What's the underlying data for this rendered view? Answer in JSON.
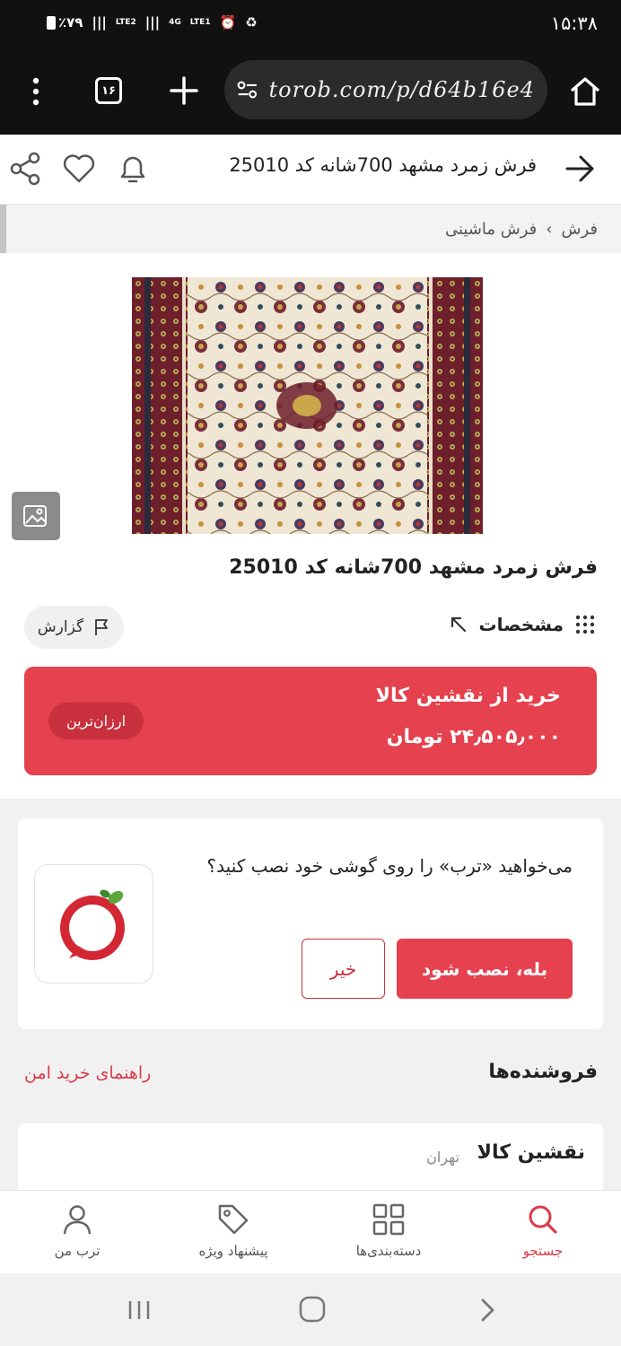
{
  "status_bar": {
    "time": "۱۵:۳۸",
    "battery": "٪۷۹",
    "network_1": "LTE2",
    "network_2": "LTE1",
    "network_type": "4G"
  },
  "browser": {
    "url": "torob.com/p/d64b16e4",
    "tab_count": "۱۶"
  },
  "header": {
    "title": "فرش زمرد مشهد 700شانه کد 25010"
  },
  "breadcrumb": {
    "items": [
      "فرش",
      "فرش ماشینی"
    ],
    "separator": "›"
  },
  "product": {
    "title": "فرش زمرد مشهد 700شانه کد 25010",
    "specs_label": "مشخصات",
    "report_label": "گزارش",
    "buy_line1": "خرید از نقشین کالا",
    "buy_price": "۲۴٫۵۰۵٫۰۰۰ تومان",
    "cheapest_badge": "ارزان‌ترین"
  },
  "install_prompt": {
    "text": "می‌خواهید «ترب» را روی گوشی خود نصب کنید؟",
    "yes_label": "بله، نصب شود",
    "no_label": "خیر"
  },
  "sellers": {
    "heading": "فروشنده‌ها",
    "safe_guide": "راهنمای خرید امن",
    "first_seller_name": "نقشین کالا",
    "first_seller_city": "تهران"
  },
  "bottom_nav": {
    "items": [
      {
        "label": "جستجو",
        "icon": "search-icon",
        "active": true
      },
      {
        "label": "دسته‌بندی‌ها",
        "icon": "grid-icon",
        "active": false
      },
      {
        "label": "پیشنهاد ویژه",
        "icon": "tag-icon",
        "active": false
      },
      {
        "label": "ترب من",
        "icon": "user-icon",
        "active": false
      }
    ]
  },
  "colors": {
    "accent": "#e5414f",
    "accent_dark": "#c9303d",
    "dark_bar": "#111111"
  }
}
